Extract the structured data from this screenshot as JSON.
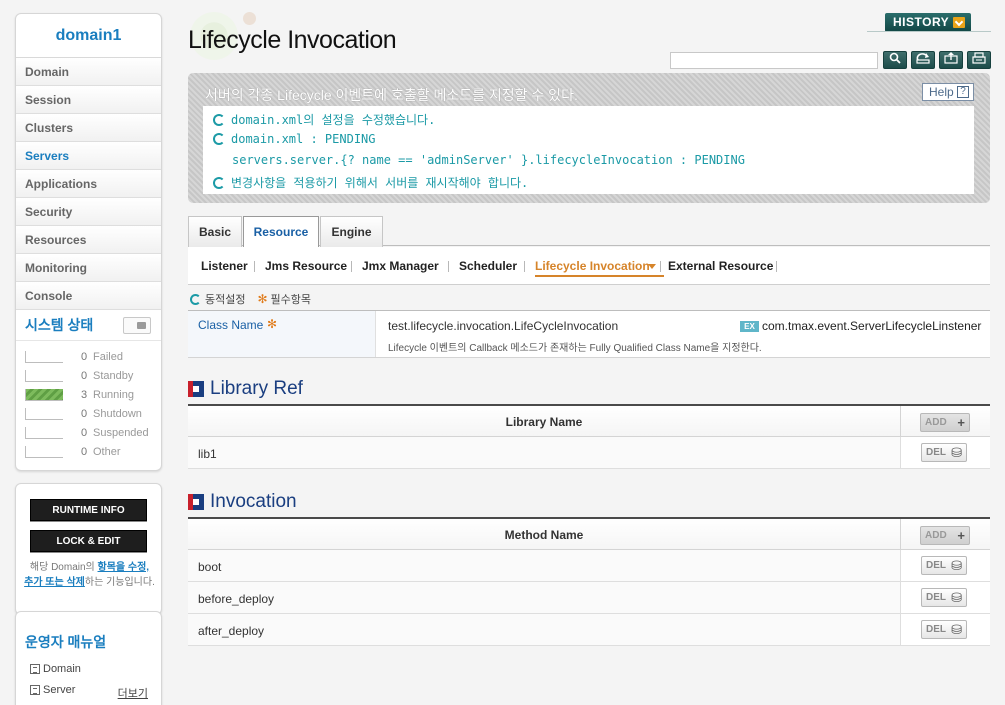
{
  "sidebar": {
    "domain_title": "domain1",
    "nav": [
      "Domain",
      "Session",
      "Clusters",
      "Servers",
      "Applications",
      "Security",
      "Resources",
      "Monitoring",
      "Console"
    ],
    "active_nav": "Servers",
    "system_status_title": "시스템 상태",
    "status": [
      {
        "count": "0",
        "label": "Failed",
        "fill": 0
      },
      {
        "count": "0",
        "label": "Standby",
        "fill": 0
      },
      {
        "count": "3",
        "label": "Running",
        "fill": 1
      },
      {
        "count": "0",
        "label": "Shutdown",
        "fill": 0
      },
      {
        "count": "0",
        "label": "Suspended",
        "fill": 0
      },
      {
        "count": "0",
        "label": "Other",
        "fill": 0
      }
    ],
    "runtime_info_label": "RUNTIME INFO",
    "lock_edit_label": "LOCK & EDIT",
    "edit_note_prefix": "해당 Domain의 ",
    "edit_note_link": "항목을 수정, 추가 또는 삭제",
    "edit_note_suffix": "하는 기능입니다.",
    "manual_title": "운영자 매뉴얼",
    "manual_items": [
      "Domain",
      "Server"
    ],
    "more_label": "더보기"
  },
  "header": {
    "title": "Lifecycle Invocation",
    "history_label": "HISTORY",
    "search_placeholder": ""
  },
  "info": {
    "title": "서버의 각종 Lifecycle 이벤트에 호출할 메소드를 지정할 수 있다.",
    "help_label": "Help",
    "messages": [
      "domain.xml의 설정을 수정했습니다.",
      "domain.xml : PENDING",
      "servers.server.{? name == 'adminServer' }.lifecycleInvocation : PENDING",
      "변경사항을 적용하기 위해서 서버를 재시작해야 합니다."
    ]
  },
  "tabs": [
    "Basic",
    "Resource",
    "Engine"
  ],
  "active_tab": "Resource",
  "subtabs": [
    "Listener",
    "Jms Resource",
    "Jmx Manager",
    "Scheduler",
    "Lifecycle Invocation",
    "External Resource"
  ],
  "active_subtab": "Lifecycle Invocation",
  "legend": {
    "dynamic": "동적설정",
    "required": "필수항목"
  },
  "class_name": {
    "label": "Class Name",
    "value": "test.lifecycle.invocation.LifeCycleInvocation",
    "description": "Lifecycle 이벤트의 Callback 메소드가 존재하는 Fully Qualified Class Name을 지정한다.",
    "example_badge": "EX",
    "example": "com.tmax.event.ServerLifecycleLinstener"
  },
  "library_ref": {
    "title": "Library Ref",
    "column": "Library Name",
    "rows": [
      "lib1"
    ],
    "add_label": "ADD",
    "del_label": "DEL"
  },
  "invocation": {
    "title": "Invocation",
    "column": "Method Name",
    "rows": [
      "boot",
      "before_deploy",
      "after_deploy"
    ],
    "add_label": "ADD",
    "del_label": "DEL"
  },
  "colors": {
    "accent": "#1a7ebf",
    "section": "#1a3e80",
    "active_subtab": "#d6842a",
    "message": "#1b9aa6"
  }
}
